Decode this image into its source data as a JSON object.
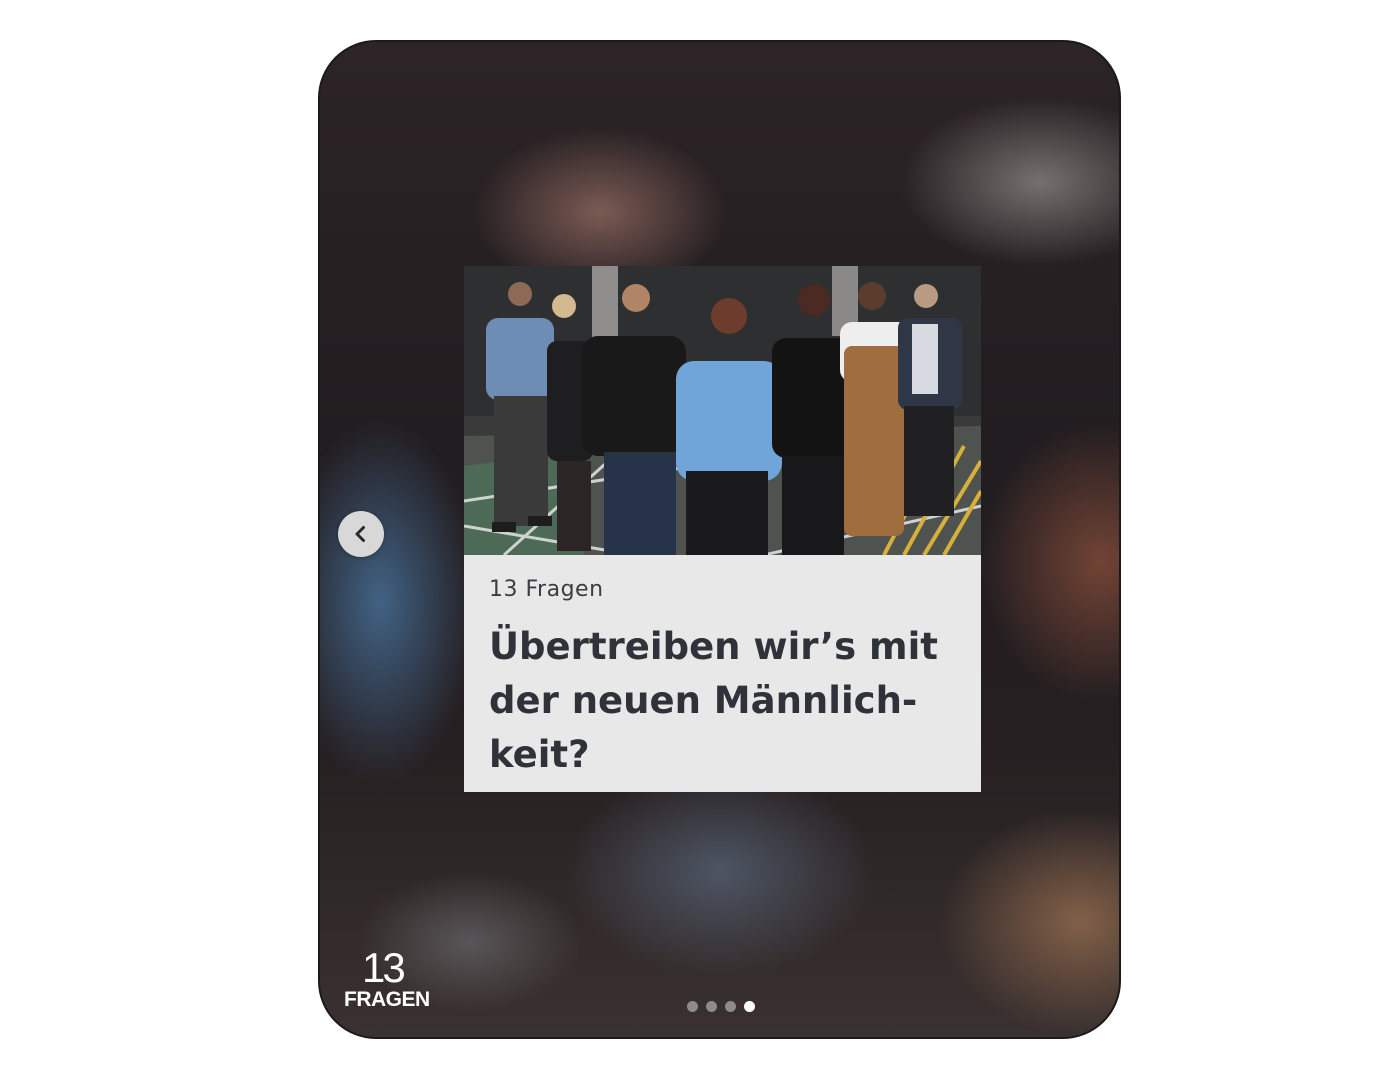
{
  "story": {
    "kicker": "13 Fragen",
    "headline": "Übertreiben wir’s mit\nder neuen Männlich-\nkeit?"
  },
  "brand": {
    "number": "13",
    "word": "FRAGEN"
  },
  "pager": {
    "count": 4,
    "active_index": 3
  },
  "icons": {
    "prev": "chevron-left-icon"
  },
  "colors": {
    "caption_background": "#e8e8e8",
    "headline_text": "#2f3339",
    "pager_active": "#ffffff",
    "pager_inactive": "#8d8b8c"
  }
}
